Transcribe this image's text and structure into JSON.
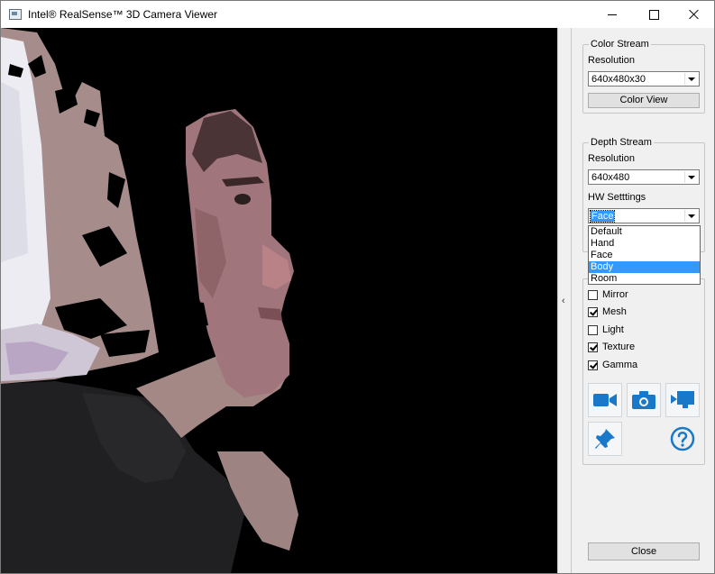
{
  "window": {
    "title": "Intel® RealSense™ 3D Camera Viewer"
  },
  "color_stream": {
    "legend": "Color Stream",
    "resolution_label": "Resolution",
    "resolution_value": "640x480x30",
    "view_button": "Color View"
  },
  "depth_stream": {
    "legend": "Depth Stream",
    "resolution_label": "Resolution",
    "resolution_value": "640x480",
    "hw_label": "HW Setttings",
    "hw_value": "Face",
    "hw_options": [
      "Default",
      "Hand",
      "Face",
      "Body",
      "Room"
    ],
    "hw_highlighted": "Body"
  },
  "options": [
    {
      "label": "Mirror",
      "checked": false
    },
    {
      "label": "Mesh",
      "checked": true
    },
    {
      "label": "Light",
      "checked": false
    },
    {
      "label": "Texture",
      "checked": true
    },
    {
      "label": "Gamma",
      "checked": true
    }
  ],
  "tools": {
    "record": "video-camera-icon",
    "snapshot": "photo-camera-icon",
    "export": "export-screen-icon",
    "pin": "pin-icon",
    "help": "help-icon"
  },
  "close_button": "Close",
  "colors": {
    "accent": "#1978c8",
    "selection": "#3399ff"
  }
}
